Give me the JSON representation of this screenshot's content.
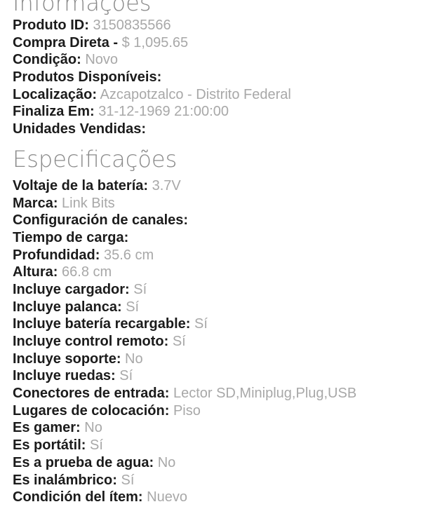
{
  "informacoes": {
    "title": "Informações",
    "rows": [
      {
        "label": "Produto ID:",
        "value": "3150835566"
      },
      {
        "label": "Compra Direta -",
        "value": "$ 1,095.65"
      },
      {
        "label": "Condição:",
        "value": "Novo"
      },
      {
        "label": "Produtos Disponíveis:",
        "value": ""
      },
      {
        "label": "Localização:",
        "value": "Azcapotzalco - Distrito Federal"
      },
      {
        "label": "Finaliza Em:",
        "value": "31-12-1969 21:00:00"
      },
      {
        "label": "Unidades Vendidas:",
        "value": ""
      }
    ]
  },
  "especificacoes": {
    "title": "Especificações",
    "rows": [
      {
        "label": "Voltaje de la batería:",
        "value": "3.7V"
      },
      {
        "label": "Marca:",
        "value": "Link Bits"
      },
      {
        "label": "Configuración de canales:",
        "value": ""
      },
      {
        "label": "Tiempo de carga:",
        "value": ""
      },
      {
        "label": "Profundidad:",
        "value": "35.6 cm"
      },
      {
        "label": "Altura:",
        "value": "66.8 cm"
      },
      {
        "label": "Incluye cargador:",
        "value": "Sí"
      },
      {
        "label": "Incluye palanca:",
        "value": "Sí"
      },
      {
        "label": "Incluye batería recargable:",
        "value": "Sí"
      },
      {
        "label": "Incluye control remoto:",
        "value": "Sí"
      },
      {
        "label": "Incluye soporte:",
        "value": "No"
      },
      {
        "label": "Incluye ruedas:",
        "value": "Sí"
      },
      {
        "label": "Conectores de entrada:",
        "value": "Lector SD,Miniplug,Plug,USB"
      },
      {
        "label": "Lugares de colocación:",
        "value": "Piso"
      },
      {
        "label": "Es gamer:",
        "value": "No"
      },
      {
        "label": "Es portátil:",
        "value": "Sí"
      },
      {
        "label": "Es a prueba de agua:",
        "value": "No"
      },
      {
        "label": "Es inalámbrico:",
        "value": "Sí"
      },
      {
        "label": "Condición del ítem:",
        "value": "Nuevo"
      }
    ]
  }
}
